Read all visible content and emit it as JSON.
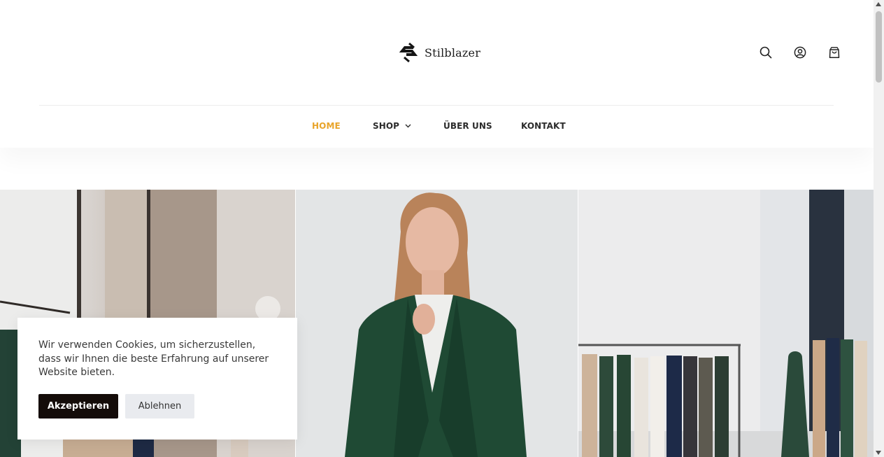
{
  "brand": {
    "name": "Stilblazer",
    "logo_icon": "s-diamond-logo-icon"
  },
  "header_icons": [
    {
      "name": "search-icon"
    },
    {
      "name": "account-icon"
    },
    {
      "name": "cart-icon"
    }
  ],
  "nav": {
    "home": "HOME",
    "shop": "SHOP",
    "about": "ÜBER UNS",
    "contact": "KONTAKT",
    "active_color": "#e8a42a"
  },
  "cookie": {
    "message": "Wir verwenden Cookies, um sicherzustellen, dass wir Ihnen die beste Erfahrung auf unserer Website bieten.",
    "accept_label": "Akzeptieren",
    "decline_label": "Ablehnen"
  },
  "colors": {
    "accent": "#e8a42a",
    "accept_bg": "#140c09",
    "decline_bg": "#e9ebef"
  }
}
